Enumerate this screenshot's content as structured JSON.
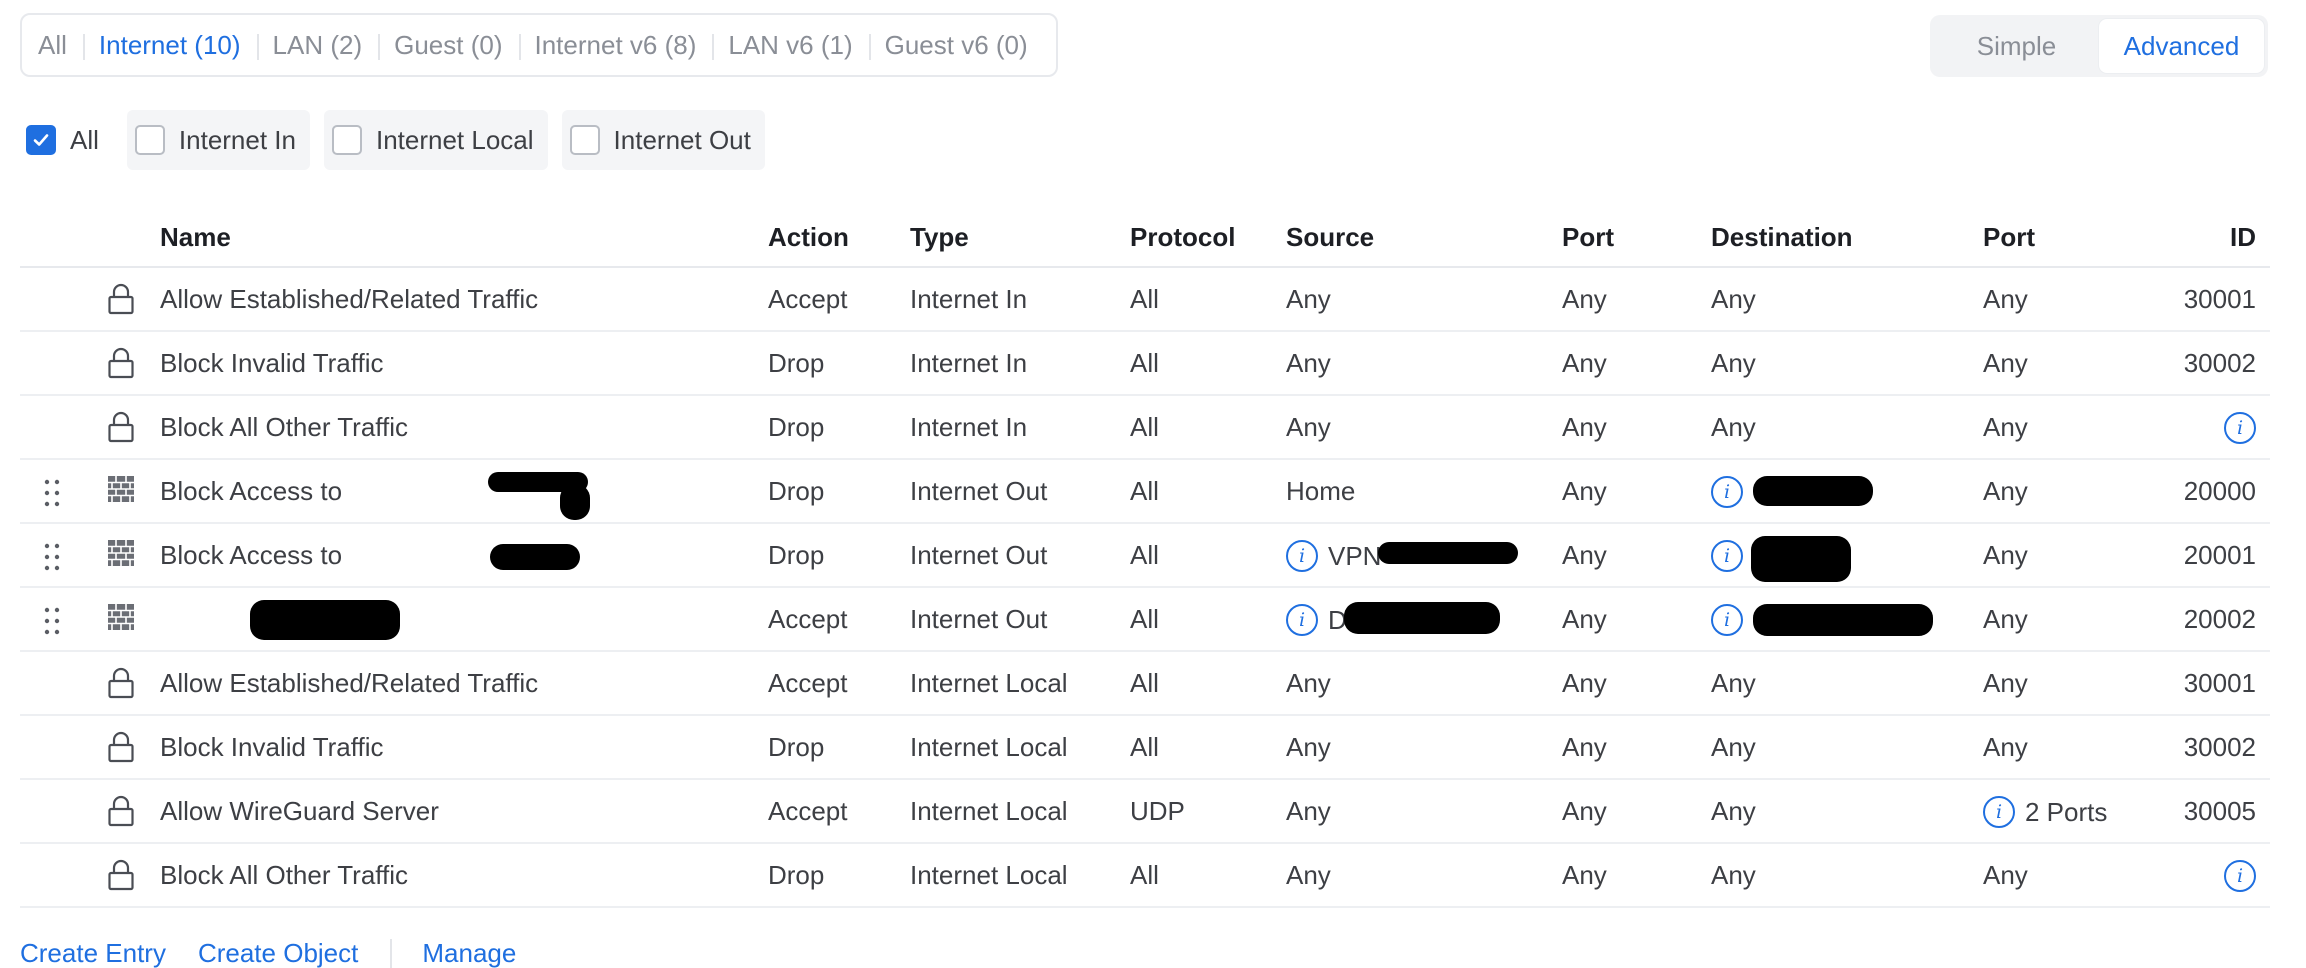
{
  "tabs": [
    {
      "label": "All"
    },
    {
      "label": "Internet (10)"
    },
    {
      "label": "LAN (2)"
    },
    {
      "label": "Guest (0)"
    },
    {
      "label": "Internet v6 (8)"
    },
    {
      "label": "LAN v6 (1)"
    },
    {
      "label": "Guest v6 (0)"
    }
  ],
  "active_tab": "Internet (10)",
  "mode": {
    "simple": "Simple",
    "advanced": "Advanced",
    "selected": "Advanced"
  },
  "filters": [
    {
      "label": "All",
      "checked": true
    },
    {
      "label": "Internet In",
      "checked": false
    },
    {
      "label": "Internet Local",
      "checked": false
    },
    {
      "label": "Internet Out",
      "checked": false
    }
  ],
  "columns": {
    "name": "Name",
    "action": "Action",
    "type": "Type",
    "protocol": "Protocol",
    "source": "Source",
    "source_port": "Port",
    "destination": "Destination",
    "destination_port": "Port",
    "id": "ID"
  },
  "rows": [
    {
      "icon": "lock-icon",
      "name": "Allow Established/Related Traffic",
      "action": "Accept",
      "type": "Internet In",
      "protocol": "All",
      "source": "Any",
      "source_port": "Any",
      "destination": "Any",
      "destination_port": "Any",
      "id": "30001"
    },
    {
      "icon": "lock-icon",
      "name": "Block Invalid Traffic",
      "action": "Drop",
      "type": "Internet In",
      "protocol": "All",
      "source": "Any",
      "source_port": "Any",
      "destination": "Any",
      "destination_port": "Any",
      "id": "30002"
    },
    {
      "icon": "lock-icon",
      "name": "Block All Other Traffic",
      "action": "Drop",
      "type": "Internet In",
      "protocol": "All",
      "source": "Any",
      "source_port": "Any",
      "destination": "Any",
      "destination_port": "Any",
      "id": ""
    },
    {
      "icon": "firewall-icon",
      "name": "Block Access to",
      "action": "Drop",
      "type": "Internet Out",
      "protocol": "All",
      "source": "Home",
      "source_port": "Any",
      "destination": "",
      "destination_port": "Any",
      "id": "20000"
    },
    {
      "icon": "firewall-icon",
      "name": "Block Access to",
      "action": "Drop",
      "type": "Internet Out",
      "protocol": "All",
      "source": "VPN-",
      "source_port": "Any",
      "destination": "",
      "destination_port": "Any",
      "id": "20001"
    },
    {
      "icon": "firewall-icon",
      "name": "",
      "action": "Accept",
      "type": "Internet Out",
      "protocol": "All",
      "source": "D",
      "source_port": "Any",
      "destination": "",
      "destination_port": "Any",
      "id": "20002"
    },
    {
      "icon": "lock-icon",
      "name": "Allow Established/Related Traffic",
      "action": "Accept",
      "type": "Internet Local",
      "protocol": "All",
      "source": "Any",
      "source_port": "Any",
      "destination": "Any",
      "destination_port": "Any",
      "id": "30001"
    },
    {
      "icon": "lock-icon",
      "name": "Block Invalid Traffic",
      "action": "Drop",
      "type": "Internet Local",
      "protocol": "All",
      "source": "Any",
      "source_port": "Any",
      "destination": "Any",
      "destination_port": "Any",
      "id": "30002"
    },
    {
      "icon": "lock-icon",
      "name": "Allow WireGuard Server",
      "action": "Accept",
      "type": "Internet Local",
      "protocol": "UDP",
      "source": "Any",
      "source_port": "Any",
      "destination": "Any",
      "destination_port": "2 Ports",
      "id": "30005"
    },
    {
      "icon": "lock-icon",
      "name": "Block All Other Traffic",
      "action": "Drop",
      "type": "Internet Local",
      "protocol": "All",
      "source": "Any",
      "source_port": "Any",
      "destination": "Any",
      "destination_port": "Any",
      "id": ""
    }
  ],
  "footer": {
    "create_entry": "Create Entry",
    "create_object": "Create Object",
    "manage": "Manage"
  },
  "colors": {
    "accent": "#1f6fe0",
    "text": "#3d3f44",
    "muted": "#8a8e96",
    "border": "#e7e9ed"
  }
}
